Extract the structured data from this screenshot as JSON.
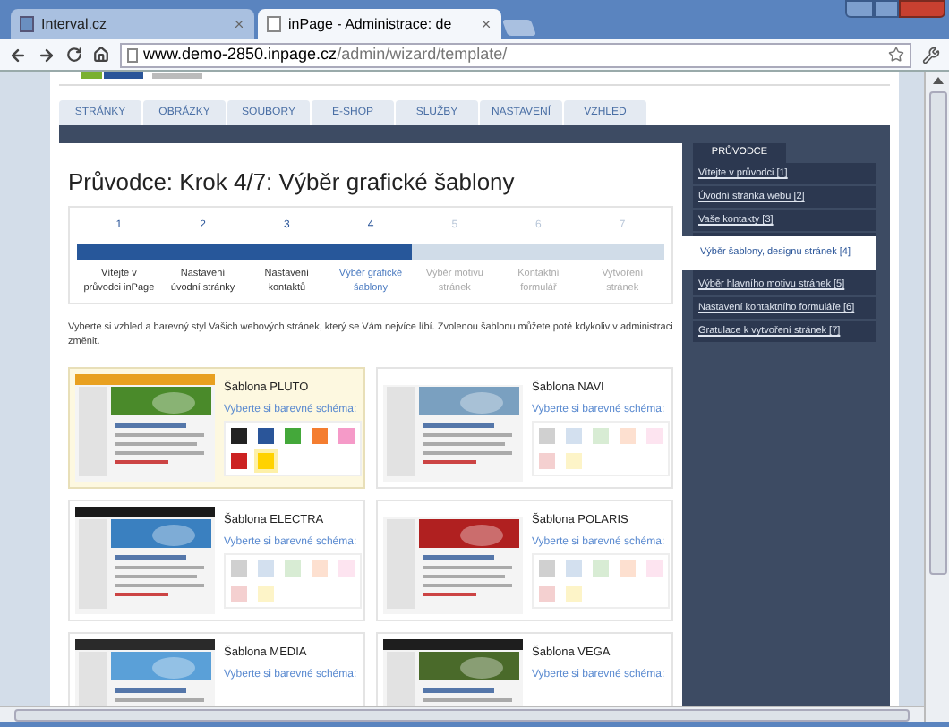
{
  "browser": {
    "tabs": [
      {
        "label": "Interval.cz",
        "selected": false
      },
      {
        "label": "inPage - Administrace: de",
        "selected": true
      }
    ],
    "address": {
      "host": "www.demo-2850.inpage.cz",
      "path": "/admin/wizard/template/"
    }
  },
  "nav": [
    {
      "label": "STRÁNKY"
    },
    {
      "label": "OBRÁZKY"
    },
    {
      "label": "SOUBORY"
    },
    {
      "label": "E-SHOP"
    },
    {
      "label": "SLUŽBY"
    },
    {
      "label": "NASTAVENÍ"
    },
    {
      "label": "VZHLED"
    }
  ],
  "title": "Průvodce: Krok 4/7: Výběr grafické šablony",
  "progress": {
    "level": 0.57,
    "steps": [
      {
        "number": "1",
        "label": "Vítejte v průvodci inPage",
        "completed": true,
        "selected": false
      },
      {
        "number": "2",
        "label": "Nastavení úvodní stránky",
        "completed": true,
        "selected": false
      },
      {
        "number": "3",
        "label": "Nastavení kontaktů",
        "completed": true,
        "selected": false
      },
      {
        "number": "4",
        "label": "Výběr grafické šablony",
        "completed": true,
        "selected": true
      },
      {
        "number": "5",
        "label": "Výběr motivu stránek",
        "completed": false,
        "selected": false
      },
      {
        "number": "6",
        "label": "Kontaktní formulář",
        "completed": false,
        "selected": false
      },
      {
        "number": "7",
        "label": "Vytvoření stránek",
        "completed": false,
        "selected": false
      }
    ]
  },
  "description": "Vyberte si vzhled a barevný styl Vašich webových stránek, který se Vám nejvíce líbí. Zvolenou šablonu můžete poté kdykoliv v administraci změnit.",
  "templates": [
    {
      "name": "Šablona PLUTO",
      "prompt": "Vyberte si barevné schéma:",
      "selected": true,
      "swatches": [
        {
          "color": "#222222",
          "selected": false
        },
        {
          "color": "#2a5599",
          "selected": false
        },
        {
          "color": "#44a83a",
          "selected": false
        },
        {
          "color": "#f47d30",
          "selected": false
        },
        {
          "color": "#f59ac8",
          "selected": false
        },
        {
          "color": "#cc2222",
          "selected": false
        },
        {
          "color": "#ffd200",
          "selected": true
        }
      ]
    },
    {
      "name": "Šablona NAVI",
      "prompt": "Vyberte si barevné schéma:",
      "selected": false,
      "swatches": [
        {
          "color": "#d0d0d0",
          "selected": false
        },
        {
          "color": "#d3e0ef",
          "selected": false
        },
        {
          "color": "#d8ecd4",
          "selected": false
        },
        {
          "color": "#fde0d0",
          "selected": false
        },
        {
          "color": "#fde4f0",
          "selected": false
        },
        {
          "color": "#f4d0d0",
          "selected": false
        },
        {
          "color": "#fdf4c8",
          "selected": false
        }
      ]
    },
    {
      "name": "Šablona ELECTRA",
      "prompt": "Vyberte si barevné schéma:",
      "selected": false,
      "swatches": [
        {
          "color": "#d0d0d0",
          "selected": false
        },
        {
          "color": "#d3e0ef",
          "selected": false
        },
        {
          "color": "#d8ecd4",
          "selected": false
        },
        {
          "color": "#fde0d0",
          "selected": false
        },
        {
          "color": "#fde4f0",
          "selected": false
        },
        {
          "color": "#f4d0d0",
          "selected": false
        },
        {
          "color": "#fdf4c8",
          "selected": false
        }
      ]
    },
    {
      "name": "Šablona POLARIS",
      "prompt": "Vyberte si barevné schéma:",
      "selected": false,
      "swatches": [
        {
          "color": "#d0d0d0",
          "selected": false
        },
        {
          "color": "#d3e0ef",
          "selected": false
        },
        {
          "color": "#d8ecd4",
          "selected": false
        },
        {
          "color": "#fde0d0",
          "selected": false
        },
        {
          "color": "#fde4f0",
          "selected": false
        },
        {
          "color": "#f4d0d0",
          "selected": false
        },
        {
          "color": "#fdf4c8",
          "selected": false
        }
      ]
    },
    {
      "name": "Šablona MEDIA",
      "prompt": "Vyberte si barevné schéma:",
      "selected": false
    },
    {
      "name": "Šablona VEGA",
      "prompt": "Vyberte si barevné schéma:",
      "selected": false
    }
  ],
  "sidebar": {
    "title": "PRŮVODCE",
    "items": [
      {
        "label": "Vítejte v průvodci [1]",
        "selected": false
      },
      {
        "label": "Úvodní stránka webu [2]",
        "selected": false
      },
      {
        "label": "Vaše kontakty [3]",
        "selected": false
      },
      {
        "label": "Výběr šablony, designu stránek [4]",
        "selected": true
      },
      {
        "label": "Výběr hlavního motivu stránek [5]",
        "selected": false
      },
      {
        "label": "Nastavení kontaktního formuláře [6]",
        "selected": false
      },
      {
        "label": "Gratulace k vytvoření stránek [7]",
        "selected": false
      }
    ]
  }
}
